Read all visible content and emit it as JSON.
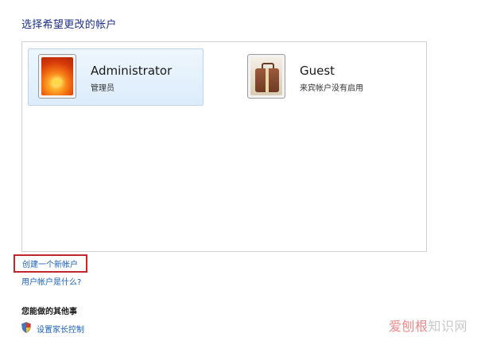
{
  "page": {
    "heading": "选择希望更改的帐户"
  },
  "accounts": [
    {
      "name": "Administrator",
      "description": "管理员",
      "icon": "flower-avatar-icon",
      "selected": true
    },
    {
      "name": "Guest",
      "description": "来宾帐户没有启用",
      "icon": "luggage-avatar-icon",
      "selected": false
    }
  ],
  "links": {
    "create_account": "创建一个新帐户",
    "what_is_account": "用户帐户是什么?"
  },
  "other_tasks": {
    "title": "您能做的其他事",
    "items": [
      {
        "label": "设置家长控制",
        "icon": "shield-icon"
      }
    ]
  },
  "watermark": {
    "accent": "爱刨根",
    "rest": "知识网"
  },
  "colors": {
    "link": "#1a5fb4",
    "heading": "#1e3287",
    "highlight_border": "#c0282d"
  }
}
